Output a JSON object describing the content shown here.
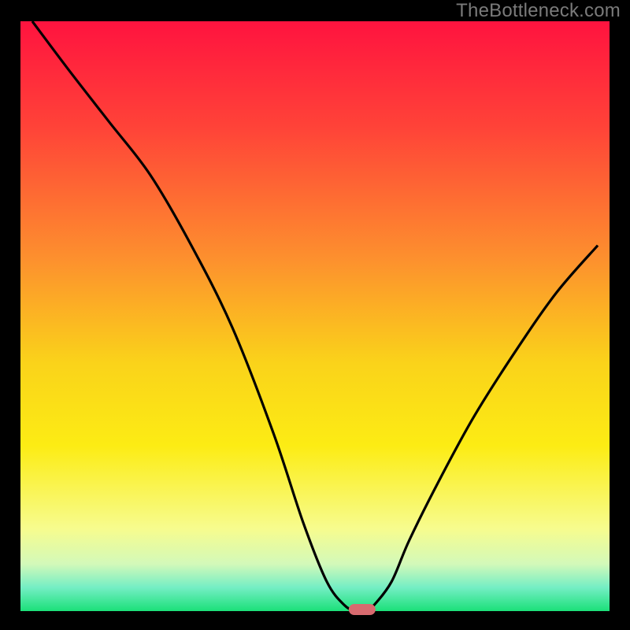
{
  "watermark": "TheBottleneck.com",
  "colors": {
    "frame": "#000000",
    "curve": "#000000",
    "marker_fill": "#d86a6f",
    "gradient_stops": [
      {
        "offset": 0.0,
        "color": "#ff133f"
      },
      {
        "offset": 0.18,
        "color": "#ff4338"
      },
      {
        "offset": 0.4,
        "color": "#fd8f2e"
      },
      {
        "offset": 0.58,
        "color": "#fad31a"
      },
      {
        "offset": 0.72,
        "color": "#fcec14"
      },
      {
        "offset": 0.86,
        "color": "#f7fc8e"
      },
      {
        "offset": 0.92,
        "color": "#d3f9b9"
      },
      {
        "offset": 0.96,
        "color": "#74eec4"
      },
      {
        "offset": 1.0,
        "color": "#1be079"
      }
    ]
  },
  "chart_data": {
    "type": "line",
    "title": "",
    "xlabel": "",
    "ylabel": "",
    "xlim": [
      0,
      100
    ],
    "ylim": [
      0,
      100
    ],
    "grid": false,
    "series": [
      {
        "name": "bottleneck-curve",
        "x": [
          2,
          8,
          15,
          22,
          29,
          36,
          43,
          48,
          52,
          55,
          57,
          58.5,
          60,
          63,
          66,
          71,
          77,
          84,
          91,
          98
        ],
        "y": [
          100,
          92,
          83,
          74,
          62,
          48,
          30,
          15,
          5,
          1,
          0,
          0,
          1,
          5,
          12,
          22,
          33,
          44,
          54,
          62
        ]
      }
    ],
    "annotations": [
      {
        "name": "min-marker",
        "x": 58,
        "y": 0
      }
    ]
  }
}
